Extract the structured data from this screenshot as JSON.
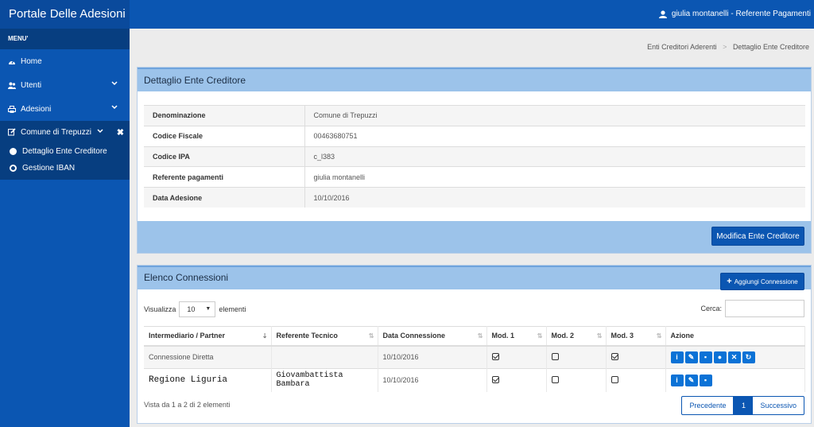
{
  "app": {
    "brand": "Portale Delle Adesioni"
  },
  "user": {
    "label": "giulia montanelli - Referente Pagamenti"
  },
  "sidebar": {
    "menu_header": "MENU'",
    "items": [
      {
        "label": "Home",
        "icon": "dashboard-icon"
      },
      {
        "label": "Utenti",
        "icon": "users-icon"
      },
      {
        "label": "Adesioni",
        "icon": "printer-icon"
      },
      {
        "label": "Comune di Trepuzzi",
        "icon": "edit-icon"
      }
    ],
    "sub_items": [
      {
        "label": "Dettaglio Ente Creditore",
        "selected": true
      },
      {
        "label": "Gestione IBAN",
        "selected": false
      }
    ]
  },
  "breadcrumb": {
    "first": "Enti Creditori Aderenti",
    "sep": ">",
    "current": "Dettaglio Ente Creditore"
  },
  "detail": {
    "title": "Dettaglio Ente Creditore",
    "rows": [
      {
        "k": "Denominazione",
        "v": "Comune di Trepuzzi"
      },
      {
        "k": "Codice Fiscale",
        "v": "00463680751"
      },
      {
        "k": "Codice IPA",
        "v": "c_l383"
      },
      {
        "k": "Referente pagamenti",
        "v": "giulia montanelli"
      },
      {
        "k": "Data Adesione",
        "v": "10/10/2016"
      }
    ],
    "edit_button": "Modifica Ente Creditore"
  },
  "connections": {
    "title": "Elenco Connessioni",
    "add_button": "Aggiungi Connessione",
    "show_label": "Visualizza",
    "page_size": "10",
    "elements_label": "elementi",
    "search_label": "Cerca:",
    "columns": [
      "Intermediario / Partner",
      "Referente Tecnico",
      "Data Connessione",
      "Mod. 1",
      "Mod. 2",
      "Mod. 3",
      "Azione"
    ],
    "rows": [
      {
        "partner": "Connessione Diretta",
        "ref": "",
        "date": "10/10/2016",
        "m1": true,
        "m2": false,
        "m3": true
      },
      {
        "partner": "Regione Liguria",
        "ref": "Giovambattista Bambara",
        "date": "10/10/2016",
        "m1": true,
        "m2": false,
        "m3": false
      }
    ],
    "info": "Vista da 1 a 2 di 2 elementi",
    "pager": {
      "prev": "Precedente",
      "current": "1",
      "next": "Successivo"
    }
  },
  "colors": {
    "primary": "#0b56b2",
    "panel_head": "#9cc3ea",
    "action": "#0b72d6"
  }
}
